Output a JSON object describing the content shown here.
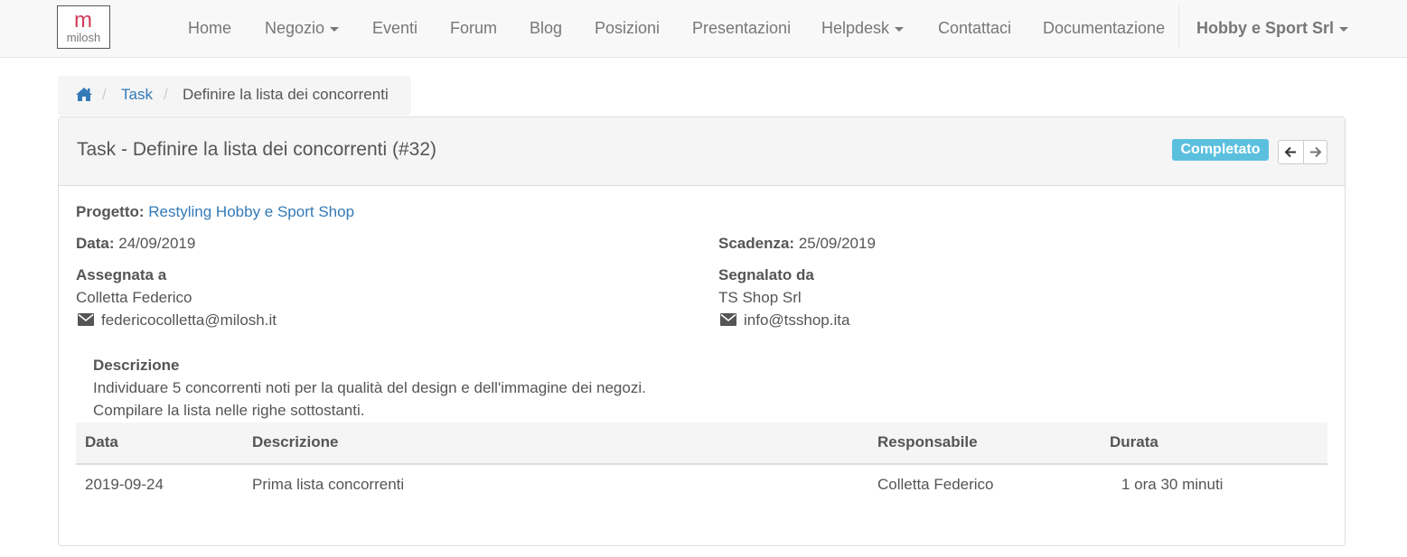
{
  "navbar": {
    "logo_text": "milosh",
    "items": [
      {
        "label": "Home"
      },
      {
        "label": "Negozio",
        "dropdown": true
      },
      {
        "label": "Eventi"
      },
      {
        "label": "Forum"
      },
      {
        "label": "Blog"
      },
      {
        "label": "Posizioni"
      },
      {
        "label": "Presentazioni"
      },
      {
        "label": "Helpdesk",
        "dropdown": true
      },
      {
        "label": "Contattaci"
      },
      {
        "label": "Documentazione"
      }
    ],
    "user_menu": "Hobby e Sport Srl"
  },
  "breadcrumb": {
    "home_icon": "home-icon",
    "items": [
      "Task",
      "Definire la lista dei concorrenti"
    ]
  },
  "task": {
    "title": "Task - Definire la lista dei concorrenti (#32)",
    "status": "Completato",
    "status_color": "#5bc0de",
    "project_label": "Progetto:",
    "project_value": "Restyling Hobby e Sport Shop",
    "date_label": "Data:",
    "date_value": "24/09/2019",
    "deadline_label": "Scadenza:",
    "deadline_value": "25/09/2019",
    "assigned_label": "Assegnata a",
    "assigned_name": "Colletta Federico",
    "assigned_email": "federicocolletta@milosh.it",
    "reported_label": "Segnalato da",
    "reported_name": "TS Shop Srl",
    "reported_email": "info@tsshop.ita",
    "description_label": "Descrizione",
    "description_lines": [
      "Individuare 5 concorrenti noti per la qualità del design e dell'immagine dei negozi.",
      "Compilare la lista nelle righe sottostanti."
    ]
  },
  "timesheet": {
    "headers": [
      "Data",
      "Descrizione",
      "Responsabile",
      "Durata"
    ],
    "rows": [
      [
        "2019-09-24",
        "Prima lista concorrenti",
        "Colletta Federico",
        "1 ora 30 minuti"
      ]
    ]
  },
  "colors": {
    "link": "#337ab7",
    "logo_accent": "#d33c5a"
  }
}
